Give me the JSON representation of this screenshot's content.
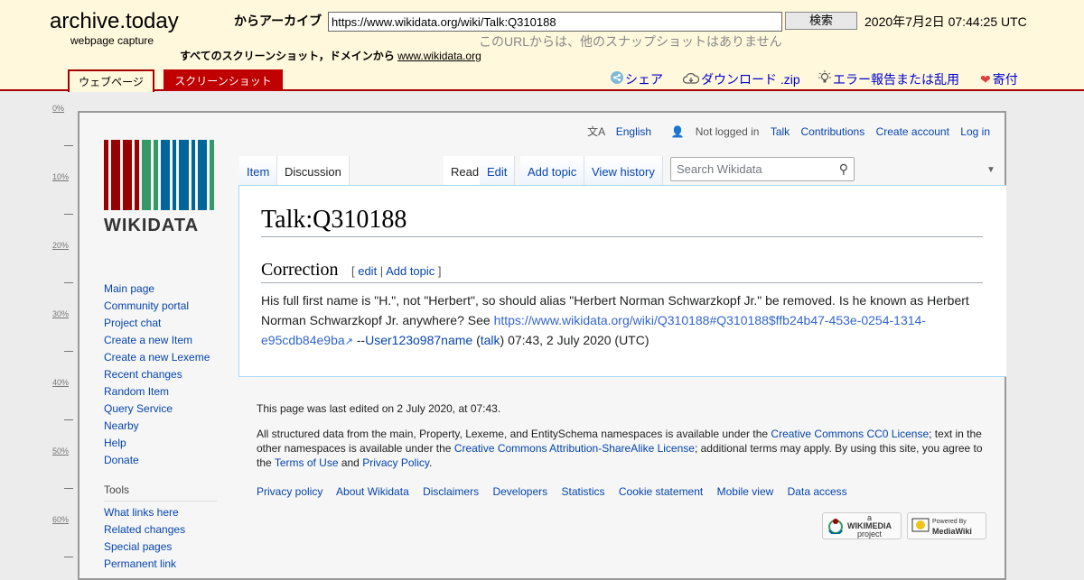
{
  "archive": {
    "logo": "archive.today",
    "subtitle": "webpage capture",
    "from_label": "からアーカイブ",
    "url": "https://www.wikidata.org/wiki/Talk:Q310188",
    "search_button": "検索",
    "date": "2020年7月2日 07:44:25 UTC",
    "no_snapshots": "このURLからは、他のスナップショットはありません",
    "all_shots_label": "すべてのスクリーンショット，ドメインから",
    "domain_link": "www.wikidata.org",
    "tab_webpage": "ウェブページ",
    "tab_screenshot": "スクリーンショット",
    "share": "シェア",
    "download": "ダウンロード .zip",
    "report": "エラー報告または乱用",
    "donate": "寄付"
  },
  "ruler": [
    "0%",
    "10%",
    "20%",
    "30%",
    "40%",
    "50%",
    "60%"
  ],
  "wiki": {
    "personal": {
      "language": "English",
      "not_logged": "Not logged in",
      "talk": "Talk",
      "contributions": "Contributions",
      "create_account": "Create account",
      "login": "Log in"
    },
    "logo_word": "WIKIDATA",
    "sidebar": [
      "Main page",
      "Community portal",
      "Project chat",
      "Create a new Item",
      "Create a new Lexeme",
      "Recent changes",
      "Random Item",
      "Query Service",
      "Nearby",
      "Help",
      "Donate"
    ],
    "tools_heading": "Tools",
    "tools": [
      "What links here",
      "Related changes",
      "Special pages",
      "Permanent link"
    ],
    "tabs": {
      "item": "Item",
      "discussion": "Discussion",
      "read": "Read",
      "edit": "Edit",
      "add_topic": "Add topic",
      "history": "View history"
    },
    "search_placeholder": "Search Wikidata",
    "page_title": "Talk:Q310188",
    "section_title": "Correction",
    "section_edit": "edit",
    "section_add_topic": "Add topic",
    "para_text": "His full first name is \"H.\", not \"Herbert\", so should alias \"Herbert Norman Schwarzkopf Jr.\" be removed. Is he known as Herbert Norman Schwarzkopf Jr. anywhere? See ",
    "para_link": "https://www.wikidata.org/wiki/Q310188#Q310188$ffb24b47-453e-0254-1314-e95cdb84e9ba",
    "para_sig_prefix": " --",
    "para_user": "User123o987name",
    "para_talk": "talk",
    "para_time": ") 07:43, 2 July 2020 (UTC)",
    "footer": {
      "last_edited": "This page was last edited on 2 July 2020, at 07:43.",
      "license_1": "All structured data from the main, Property, Lexeme, and EntitySchema namespaces is available under the ",
      "cc0": "Creative Commons CC0 License",
      "license_2": "; text in the other namespaces is available under the ",
      "ccbysa": "Creative Commons Attribution-ShareAlike License",
      "license_3": "; additional terms may apply. By using this site, you agree to the ",
      "terms": "Terms of Use",
      "and": " and ",
      "privacy": "Privacy Policy",
      "dot": ".",
      "links": [
        "Privacy policy",
        "About Wikidata",
        "Disclaimers",
        "Developers",
        "Statistics",
        "Cookie statement",
        "Mobile view",
        "Data access"
      ],
      "wikimedia_small": "a",
      "wikimedia_name": "WIKIMEDIA",
      "wikimedia_sub": "project",
      "mediawiki_small": "Powered By",
      "mediawiki_name": "MediaWiki"
    }
  },
  "colors": {
    "archive_bg": "#fff8dc",
    "archive_red": "#a80000",
    "link_blue": "#0645ad",
    "logo_red": "#990000",
    "logo_green": "#339966",
    "logo_blue": "#006699"
  }
}
